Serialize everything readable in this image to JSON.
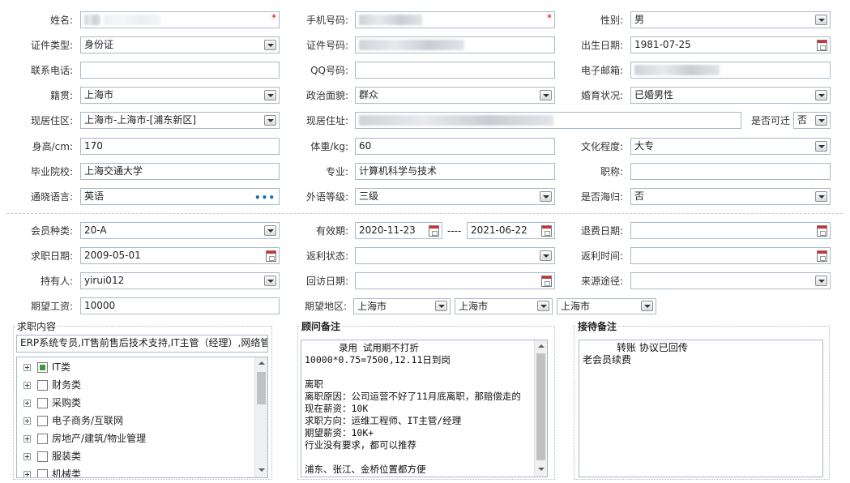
{
  "form": {
    "name": {
      "label": "姓名:",
      "value": ""
    },
    "mobile": {
      "label": "手机号码:",
      "value": ""
    },
    "gender": {
      "label": "性别:",
      "value": "男"
    },
    "id_type": {
      "label": "证件类型:",
      "value": "身份证"
    },
    "id_number": {
      "label": "证件号码:",
      "value": ""
    },
    "birthdate": {
      "label": "出生日期:",
      "value": "1981-07-25"
    },
    "phone": {
      "label": "联系电话:",
      "value": ""
    },
    "qq": {
      "label": "QQ号码:",
      "value": ""
    },
    "email": {
      "label": "电子邮箱:",
      "value": ""
    },
    "native_place": {
      "label": "籍贯:",
      "value": "上海市"
    },
    "political": {
      "label": "政治面貌:",
      "value": "群众"
    },
    "marital": {
      "label": "婚育状况:",
      "value": "已婚男性"
    },
    "residence_area": {
      "label": "现居住区:",
      "value": "上海市-上海市-[浦东新区]"
    },
    "residence_addr": {
      "label": "现居住址:",
      "value": ""
    },
    "relocate": {
      "label": "是否可迁",
      "value": "否"
    },
    "height": {
      "label": "身高/cm:",
      "value": "170"
    },
    "weight": {
      "label": "体重/kg:",
      "value": "60"
    },
    "education": {
      "label": "文化程度:",
      "value": "大专"
    },
    "school": {
      "label": "毕业院校:",
      "value": "上海交通大学"
    },
    "major": {
      "label": "专业:",
      "value": "计算机科学与技术"
    },
    "title": {
      "label": "职称:",
      "value": ""
    },
    "language": {
      "label": "通晓语言:",
      "value": "英语",
      "more": "•••"
    },
    "lang_level": {
      "label": "外语等级:",
      "value": "三级"
    },
    "overseas": {
      "label": "是否海归:",
      "value": "否"
    }
  },
  "membership": {
    "member_type": {
      "label": "会员种类:",
      "value": "20-A"
    },
    "validity": {
      "label": "有效期:",
      "start": "2020-11-23",
      "sep": "----",
      "end": "2021-06-22"
    },
    "refund_date": {
      "label": "退费日期:",
      "value": ""
    },
    "job_date": {
      "label": "求职日期:",
      "value": "2009-05-01"
    },
    "rebate_status": {
      "label": "返利状态:",
      "value": ""
    },
    "rebate_time": {
      "label": "返利时间:",
      "value": ""
    },
    "holder": {
      "label": "持有人:",
      "value": "yirui012"
    },
    "visit_date": {
      "label": "回访日期:",
      "value": ""
    },
    "source": {
      "label": "来源途径:",
      "value": ""
    },
    "salary": {
      "label": "期望工资:",
      "value": "10000"
    },
    "region": {
      "label": "期望地区:",
      "values": [
        "上海市",
        "上海市",
        "上海市"
      ]
    }
  },
  "job_content": {
    "title": "求职内容",
    "summary": "ERP系统专员,IT售前售后技术支持,IT主管（经理）,网络管",
    "categories": [
      {
        "label": "IT类",
        "checked": true
      },
      {
        "label": "财务类",
        "checked": false
      },
      {
        "label": "采购类",
        "checked": false
      },
      {
        "label": "电子商务/互联网",
        "checked": false
      },
      {
        "label": "房地产/建筑/物业管理",
        "checked": false
      },
      {
        "label": "服装类",
        "checked": false
      },
      {
        "label": "机械类",
        "checked": false
      }
    ]
  },
  "advisor_notes": {
    "title": "顾问备注",
    "text": "录用 试用期不打折10000*0.75=7500,12.11日到岗\n\n离职\n离职原因：公司运营不好了11月底离职，那赔偿走的\n现在薪资：10K\n求职方向：运维工程师、IT主管/经理\n期望薪资：10K+\n行业没有要求，都可以推荐\n\n浦东、张江、金桥位置都方便"
  },
  "reception_notes": {
    "title": "接待备注",
    "text": "转账 协议已回传\n老会员续费"
  },
  "colors": {
    "border": "#a9b9c9",
    "required": "#dd0000",
    "link": "#1a6fb3"
  }
}
